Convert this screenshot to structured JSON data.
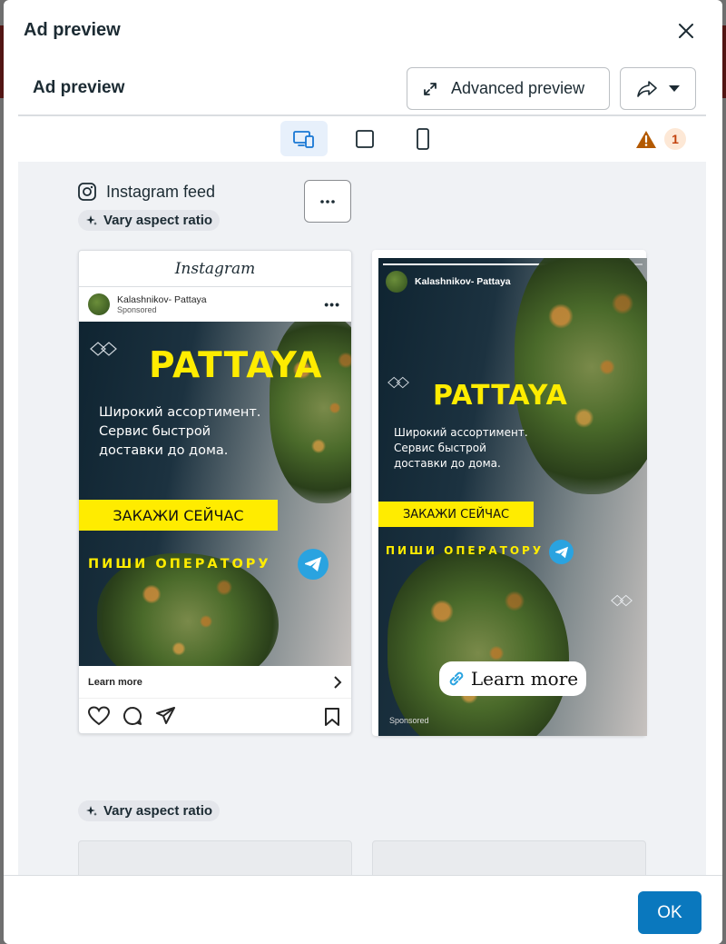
{
  "modal": {
    "title": "Ad preview",
    "sub_title": "Ad preview",
    "advanced_preview_label": "Advanced preview",
    "warning_count": "1",
    "ok_label": "OK"
  },
  "placement": {
    "name": "Instagram feed",
    "vary_aspect_ratio": "Vary aspect ratio",
    "vary_aspect_ratio_2": "Vary aspect ratio"
  },
  "feed_ad": {
    "platform_logo": "Instagram",
    "account_name": "Kalashnikov- Pattaya",
    "sponsored": "Sponsored",
    "headline": "PATTAYA",
    "body_line_1": "Широкий ассортимент.",
    "body_line_2": "Сервис быстрой",
    "body_line_3": "доставки до дома.",
    "cta_yellow": "ЗАКАЖИ СЕЙЧАС",
    "operator_text": "ПИШИ ОПЕРАТОРУ",
    "learn_more": "Learn more"
  },
  "story_ad": {
    "account_name": "Kalashnikov- Pattaya",
    "headline": "PATTAYA",
    "body_line_1": "Широкий ассортимент.",
    "body_line_2": "Сервис быстрой",
    "body_line_3": "доставки до дома.",
    "cta_yellow": "ЗАКАЖИ СЕЙЧАС",
    "operator_text": "ПИШИ ОПЕРАТОРУ",
    "learn_more": "Learn more",
    "sponsored": "Sponsored"
  },
  "icons": {
    "close": "close-icon",
    "advanced": "expand-arrows-icon",
    "share": "share-icon",
    "dropdown": "caret-down-icon",
    "device_all": "desktop-mobile-icon",
    "device_square": "square-frame-icon",
    "device_mobile": "mobile-frame-icon",
    "warning": "warning-triangle-icon",
    "instagram": "instagram-icon",
    "sparkle": "sparkle-icon",
    "telegram": "telegram-icon",
    "link": "link-icon"
  },
  "colors": {
    "primary": "#0a78be",
    "warning": "#b35900",
    "ad_yellow": "#ffec00",
    "telegram": "#2aa3e0"
  }
}
